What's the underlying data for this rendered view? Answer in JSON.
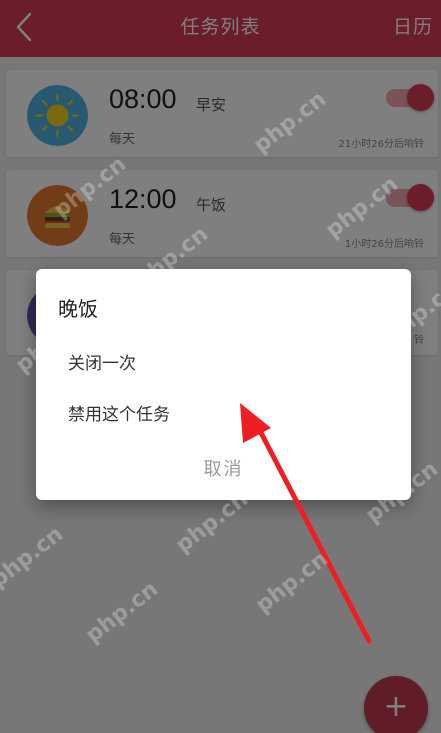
{
  "header": {
    "title": "任务列表",
    "calendar_label": "日历",
    "color": "#d63a52"
  },
  "tasks": [
    {
      "time": "08:00",
      "name": "早安",
      "repeat": "每天",
      "remaining": "21小时26分后响铃",
      "icon": "sun-icon",
      "enabled": true
    },
    {
      "time": "12:00",
      "name": "午饭",
      "repeat": "每天",
      "remaining": "1小时26分后响铃",
      "icon": "burger-icon",
      "enabled": true
    },
    {
      "time": "",
      "name": "",
      "repeat": "",
      "remaining": "铃",
      "icon": "moon-icon",
      "enabled": true
    }
  ],
  "dialog": {
    "title": "晚饭",
    "options": [
      "关闭一次",
      "禁用这个任务"
    ],
    "cancel": "取消"
  },
  "fab": {
    "label": "+",
    "icon": "plus-icon"
  },
  "watermark": "php.cn"
}
